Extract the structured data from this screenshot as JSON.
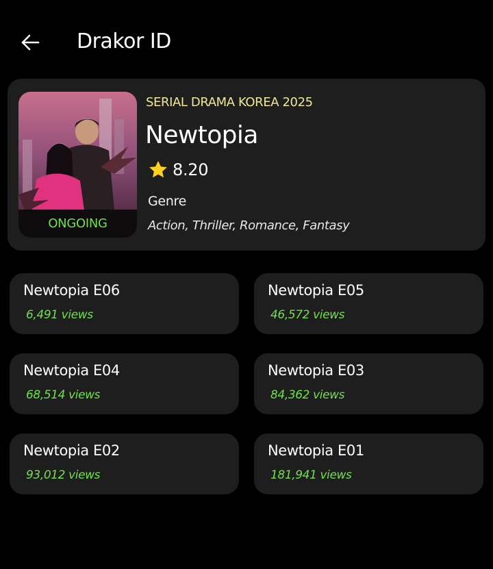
{
  "header": {
    "title": "Drakor ID",
    "back_icon": "arrow-left-icon"
  },
  "detail": {
    "category": "SERIAL DRAMA KOREA 2025",
    "title": "Newtopia",
    "status": "ONGOING",
    "rating": "8.20",
    "rating_icon": "star-icon",
    "genre_label": "Genre",
    "genres": "Action, Thriller, Romance, Fantasy"
  },
  "episodes": [
    {
      "title": "Newtopia E06",
      "views": "6,491 views"
    },
    {
      "title": "Newtopia E05",
      "views": "46,572 views"
    },
    {
      "title": "Newtopia E04",
      "views": "68,514 views"
    },
    {
      "title": "Newtopia E03",
      "views": "84,362 views"
    },
    {
      "title": "Newtopia E02",
      "views": "93,012 views"
    },
    {
      "title": "Newtopia E01",
      "views": "181,941 views"
    }
  ],
  "colors": {
    "background": "#000000",
    "card": "#1e1e1e",
    "accent_green": "#6fe04a",
    "category_yellow": "#f1e79a",
    "star": "#ffd21f"
  }
}
